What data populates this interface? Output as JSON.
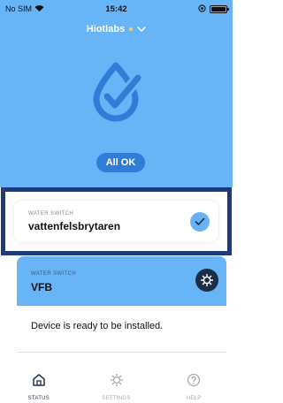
{
  "status_bar": {
    "carrier": "No SIM",
    "time": "15:42"
  },
  "header": {
    "location_name": "Hiotlabs"
  },
  "overall_status": {
    "label": "All OK"
  },
  "devices": [
    {
      "type_label": "WATER SWITCH",
      "name": "vattenfelsbrytaren",
      "state_icon": "check-icon"
    },
    {
      "type_label": "WATER SWITCH",
      "name": "VFB",
      "state_icon": "bug-icon",
      "message": "Device is ready to be installed."
    }
  ],
  "tabbar": {
    "items": [
      {
        "label": "STATUS",
        "icon": "home-icon",
        "active": true
      },
      {
        "label": "SETTINGS",
        "icon": "gear-icon",
        "active": false
      },
      {
        "label": "HELP",
        "icon": "help-icon",
        "active": false
      }
    ]
  },
  "colors": {
    "header_blue": "#67b4f7",
    "button_blue": "#2f7dd6",
    "highlight_navy": "#1e3a7b",
    "badge_dark": "#1c2d46",
    "location_dot": "#f3d06c"
  }
}
